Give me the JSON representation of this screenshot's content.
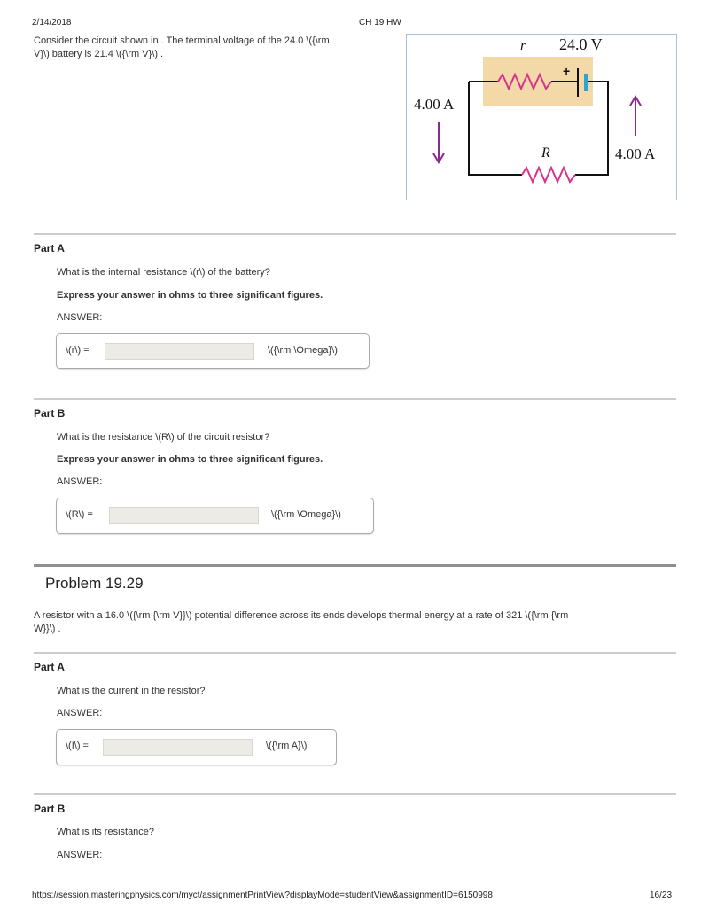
{
  "header": {
    "date": "2/14/2018",
    "title": "CH 19 HW"
  },
  "intro": {
    "line1": "Consider the circuit shown in . The terminal voltage of the 24.0 \\({\\rm",
    "line2": "V}\\) battery is 21.4 \\({\\rm V}\\) ."
  },
  "figure": {
    "r_label": "r",
    "emf_label": "24.0 V",
    "current_left": "4.00 A",
    "current_right": "4.00 A",
    "R_label": "R",
    "plus": "+"
  },
  "problem1": {
    "partA": {
      "title": "Part A",
      "question": "What is the internal resistance \\(r\\) of the battery?",
      "instruction": "Express your answer in ohms to three significant figures.",
      "answer_label": "ANSWER:",
      "var_label": "\\(r\\) =",
      "input_value": "",
      "unit": "\\({\\rm \\Omega}\\)"
    },
    "partB": {
      "title": "Part B",
      "question": "What is the resistance \\(R\\) of the circuit resistor?",
      "instruction": "Express your answer in ohms to three significant figures.",
      "answer_label": "ANSWER:",
      "var_label": "\\(R\\) =",
      "input_value": "",
      "unit": "\\({\\rm \\Omega}\\)"
    }
  },
  "problem2": {
    "title": "Problem 19.29",
    "text_line1": "A resistor with a 16.0 \\({\\rm {\\rm V}}\\) potential difference across its ends develops thermal energy at a rate of 321 \\({\\rm {\\rm",
    "text_line2": "W}}\\) .",
    "partA": {
      "title": "Part A",
      "question": "What is the current in the resistor?",
      "answer_label": "ANSWER:",
      "var_label": "\\(I\\) =",
      "input_value": "",
      "unit": "\\({\\rm A}\\)"
    },
    "partB": {
      "title": "Part B",
      "question": "What is its resistance?",
      "answer_label": "ANSWER:"
    }
  },
  "footer": {
    "url": "https://session.masteringphysics.com/myct/assignmentPrintView?displayMode=studentView&assignmentID=6150998",
    "page": "16/23"
  },
  "colors": {
    "wire": "#111111",
    "resistor": "#d6338f",
    "arrow": "#8a2a8f",
    "battery_box": "#f3d9a8",
    "battery_plate": "#2aa5d6"
  }
}
